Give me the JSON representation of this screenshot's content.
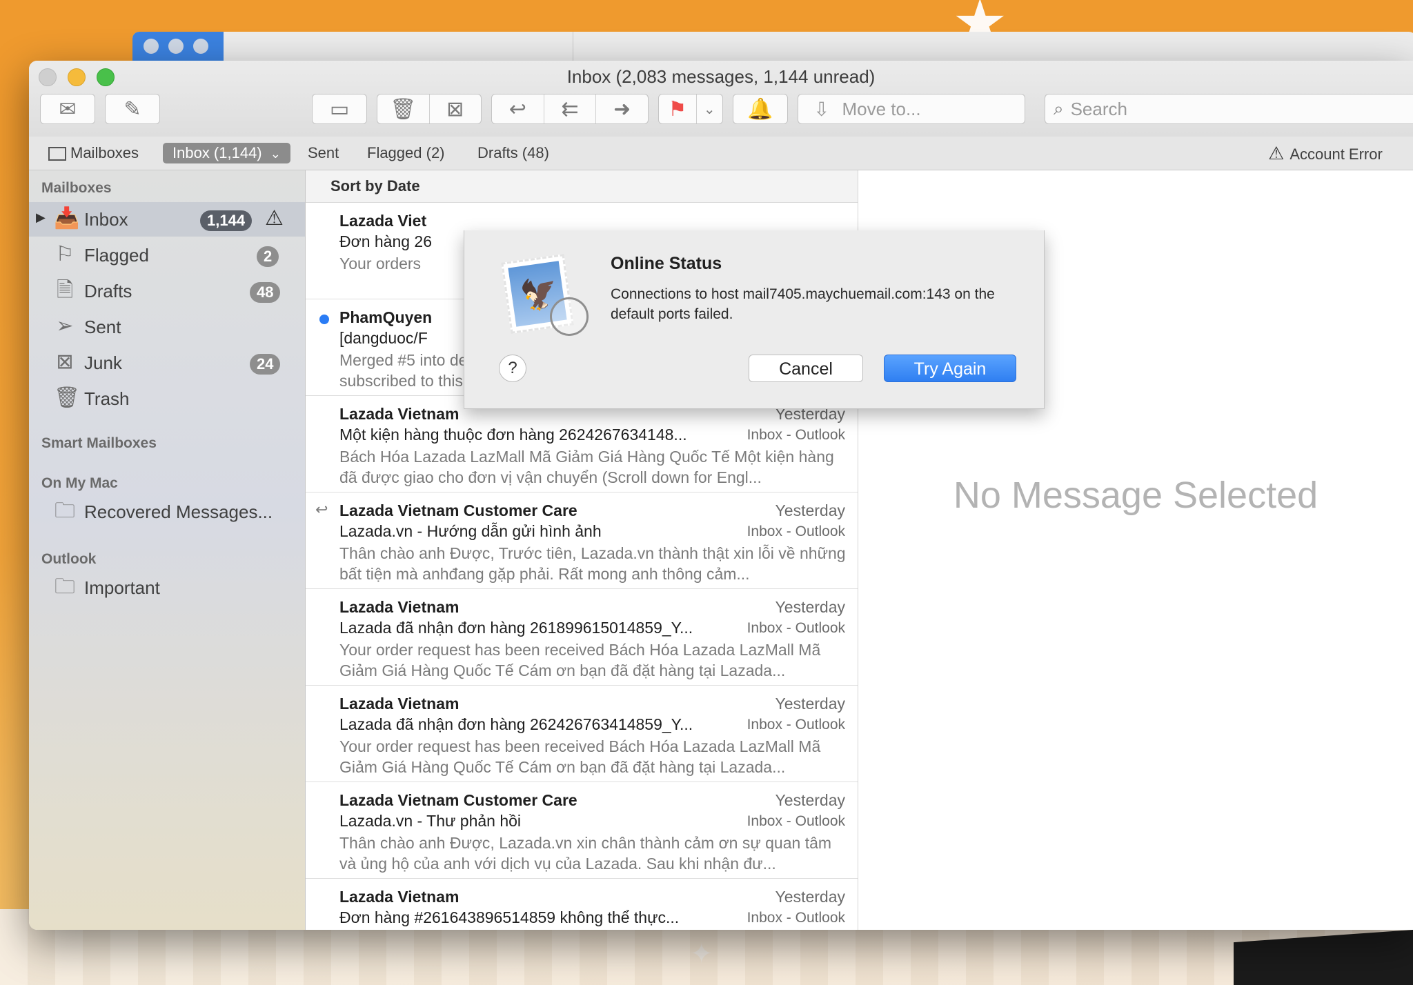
{
  "window": {
    "title": "Inbox (2,083 messages, 1,144 unread)"
  },
  "toolbar": {
    "move_to": "Move to...",
    "search_placeholder": "Search"
  },
  "favorites": {
    "mailboxes": "Mailboxes",
    "inbox": "Inbox (1,144)",
    "sent": "Sent",
    "flagged": "Flagged (2)",
    "drafts": "Drafts (48)",
    "account_error": "Account Error"
  },
  "sidebar": {
    "mailboxes_header": "Mailboxes",
    "items": [
      {
        "label": "Inbox",
        "badge": "1,144"
      },
      {
        "label": "Flagged",
        "badge": "2"
      },
      {
        "label": "Drafts",
        "badge": "48"
      },
      {
        "label": "Sent",
        "badge": ""
      },
      {
        "label": "Junk",
        "badge": "24"
      },
      {
        "label": "Trash",
        "badge": ""
      }
    ],
    "smart_header": "Smart Mailboxes",
    "onmymac_header": "On My Mac",
    "recovered": "Recovered Messages...",
    "outlook_header": "Outlook",
    "important": "Important"
  },
  "list": {
    "sort": "Sort by Date",
    "messages": [
      {
        "from": "Lazada Viet",
        "date": "",
        "subject": "Đơn hàng 26",
        "mailbox": "",
        "preview": "Your orders"
      },
      {
        "from": "PhamQuyen",
        "date": "",
        "subject": "[dangduoc/F",
        "mailbox": "",
        "preview": "Merged #5 into developer. — You are receiving this because you are subscribed to this thread. Reply to this e..."
      },
      {
        "from": "Lazada Vietnam",
        "date": "Yesterday",
        "subject": "Một kiện hàng thuộc đơn hàng 2624267634148...",
        "mailbox": "Inbox - Outlook",
        "preview": "Bách Hóa Lazada LazMall Mã Giảm Giá Hàng Quốc Tế Một kiện hàng đã được giao cho đơn vị vận chuyển (Scroll down for Engl..."
      },
      {
        "from": "Lazada Vietnam Customer Care",
        "date": "Yesterday",
        "subject": "Lazada.vn - Hướng dẫn gửi hình ảnh",
        "mailbox": "Inbox - Outlook",
        "preview": "Thân chào anh Được, Trước tiên, Lazada.vn thành thật xin lỗi về những bất tiện mà anhđang gặp phải. Rất mong anh thông cảm..."
      },
      {
        "from": "Lazada Vietnam",
        "date": "Yesterday",
        "subject": "Lazada đã nhận đơn hàng 261899615014859_Y...",
        "mailbox": "Inbox - Outlook",
        "preview": "Your order request has been received Bách Hóa Lazada LazMall Mã Giảm Giá Hàng Quốc Tế Cám ơn bạn đã đặt hàng tại Lazada..."
      },
      {
        "from": "Lazada Vietnam",
        "date": "Yesterday",
        "subject": "Lazada đã nhận đơn hàng 262426763414859_Y...",
        "mailbox": "Inbox - Outlook",
        "preview": "Your order request has been received Bách Hóa Lazada LazMall Mã Giảm Giá Hàng Quốc Tế Cám ơn bạn đã đặt hàng tại Lazada..."
      },
      {
        "from": "Lazada Vietnam Customer Care",
        "date": "Yesterday",
        "subject": "Lazada.vn - Thư phản hồi",
        "mailbox": "Inbox - Outlook",
        "preview": "Thân chào anh Được, Lazada.vn xin chân thành cảm ơn sự quan tâm và ủng hộ của anh với dịch vụ của Lazada. Sau khi nhận đư..."
      },
      {
        "from": "Lazada Vietnam",
        "date": "Yesterday",
        "subject": "Đơn hàng #261643896514859 không thể thực...",
        "mailbox": "Inbox - Outlook",
        "preview": ""
      }
    ]
  },
  "viewer": {
    "empty": "No Message Selected"
  },
  "alert": {
    "title": "Online Status",
    "message": "Connections to host mail7405.maychuemail.com:143 on the default ports failed.",
    "help": "?",
    "cancel": "Cancel",
    "try_again": "Try Again"
  },
  "colors": {
    "accent": "#2f7ff1",
    "unread_dot": "#2a7cf5",
    "desktop": "#f2a43a"
  }
}
